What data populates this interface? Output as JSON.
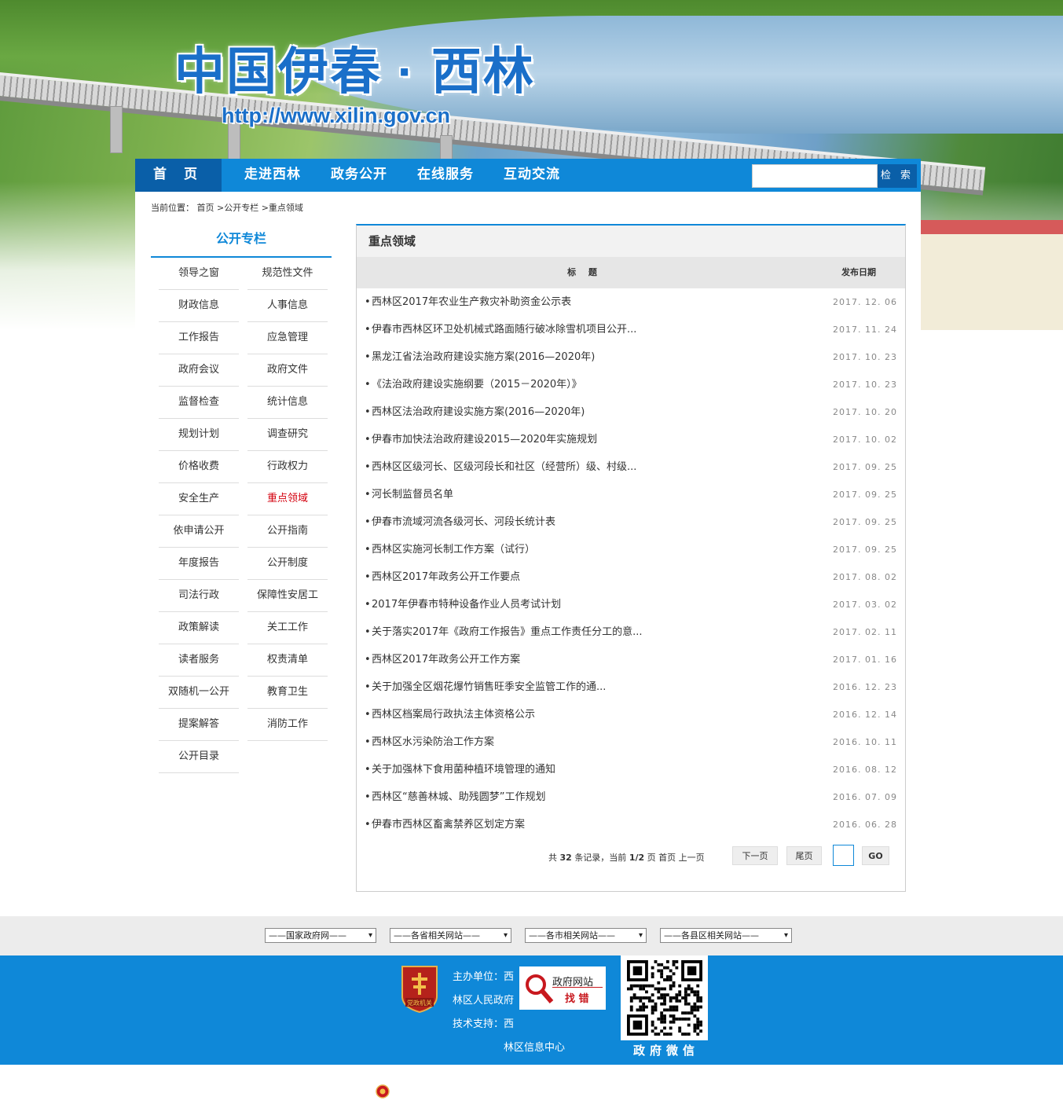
{
  "site": {
    "title": "中国伊春 · 西林",
    "url": "http://www.xilin.gov.cn"
  },
  "nav": {
    "items": [
      "首 页",
      "走进西林",
      "政务公开",
      "在线服务",
      "互动交流"
    ],
    "search_placeholder": "",
    "search_button": "检 索"
  },
  "breadcrumb": "当前位置： 首页 >公开专栏 >重点领域",
  "sidebar": {
    "title": "公开专栏",
    "items": [
      "领导之窗",
      "规范性文件",
      "财政信息",
      "人事信息",
      "工作报告",
      "应急管理",
      "政府会议",
      "政府文件",
      "监督检查",
      "统计信息",
      "规划计划",
      "调查研究",
      "价格收费",
      "行政权力",
      "安全生产",
      "重点领域",
      "依申请公开",
      "公开指南",
      "年度报告",
      "公开制度",
      "司法行政",
      "保障性安居工",
      "政策解读",
      "关工工作",
      "读者服务",
      "权责清单",
      "双随机一公开",
      "教育卫生",
      "提案解答",
      "消防工作",
      "公开目录"
    ],
    "active": "重点领域"
  },
  "content": {
    "title": "重点领域",
    "col_title": "标 题",
    "col_date": "发布日期",
    "rows": [
      {
        "title": "西林区2017年农业生产救灾补助资金公示表",
        "date": "2017. 12. 06"
      },
      {
        "title": "伊春市西林区环卫处机械式路面随行破冰除雪机项目公开...",
        "date": "2017. 11. 24"
      },
      {
        "title": "黑龙江省法治政府建设实施方案(2016—2020年)",
        "date": "2017. 10. 23"
      },
      {
        "title": "《法治政府建设实施纲要（2015－2020年）》",
        "date": "2017. 10. 23"
      },
      {
        "title": "西林区法治政府建设实施方案(2016—2020年)",
        "date": "2017. 10. 20"
      },
      {
        "title": "伊春市加快法治政府建设2015—2020年实施规划",
        "date": "2017. 10. 02"
      },
      {
        "title": "西林区区级河长、区级河段长和社区（经营所）级、村级...",
        "date": "2017. 09. 25"
      },
      {
        "title": "河长制监督员名单",
        "date": "2017. 09. 25"
      },
      {
        "title": "伊春市流域河流各级河长、河段长统计表",
        "date": "2017. 09. 25"
      },
      {
        "title": "西林区实施河长制工作方案（试行）",
        "date": "2017. 09. 25"
      },
      {
        "title": "西林区2017年政务公开工作要点",
        "date": "2017. 08. 02"
      },
      {
        "title": "2017年伊春市特种设备作业人员考试计划",
        "date": "2017. 03. 02"
      },
      {
        "title": "关于落实2017年《政府工作报告》重点工作责任分工的意...",
        "date": "2017. 02. 11"
      },
      {
        "title": "西林区2017年政务公开工作方案",
        "date": "2017. 01. 16"
      },
      {
        "title": "关于加强全区烟花爆竹销售旺季安全监管工作的通...",
        "date": "2016. 12. 23"
      },
      {
        "title": "西林区档案局行政执法主体资格公示",
        "date": "2016. 12. 14"
      },
      {
        "title": "西林区水污染防治工作方案",
        "date": "2016. 10. 11"
      },
      {
        "title": "关于加强林下食用菌种植环境管理的通知",
        "date": "2016. 08. 12"
      },
      {
        "title": "西林区“慈善林城、助残圆梦”工作规划",
        "date": "2016. 07. 09"
      },
      {
        "title": "伊春市西林区畜禽禁养区划定方案",
        "date": "2016. 06. 28"
      }
    ]
  },
  "pager": {
    "total_prefix": "共",
    "total": "32",
    "total_suffix": "条记录，当前",
    "page": "1/2",
    "page_suffix": "页",
    "first": "首页",
    "prev": "上一页",
    "next": "下一页",
    "last": "尾页",
    "go": "GO"
  },
  "links": [
    "——国家政府网——",
    "——各省相关网站——",
    "——各市相关网站——",
    "——各县区相关网站——"
  ],
  "footer": {
    "emblem_text": "党政机关",
    "host_label_1": "主办单位：西",
    "host_label_2": "林区人民政府",
    "tech_label_1": "技术支持：西",
    "tech_label_2": "林区信息中心",
    "jiucuo_top": "政府网站",
    "jiucuo_bottom": "找 错",
    "wechat": "政府微信"
  },
  "colors": {
    "primary": "#0f88d8",
    "dark": "#0a5fa8",
    "active": "#d4000e"
  }
}
